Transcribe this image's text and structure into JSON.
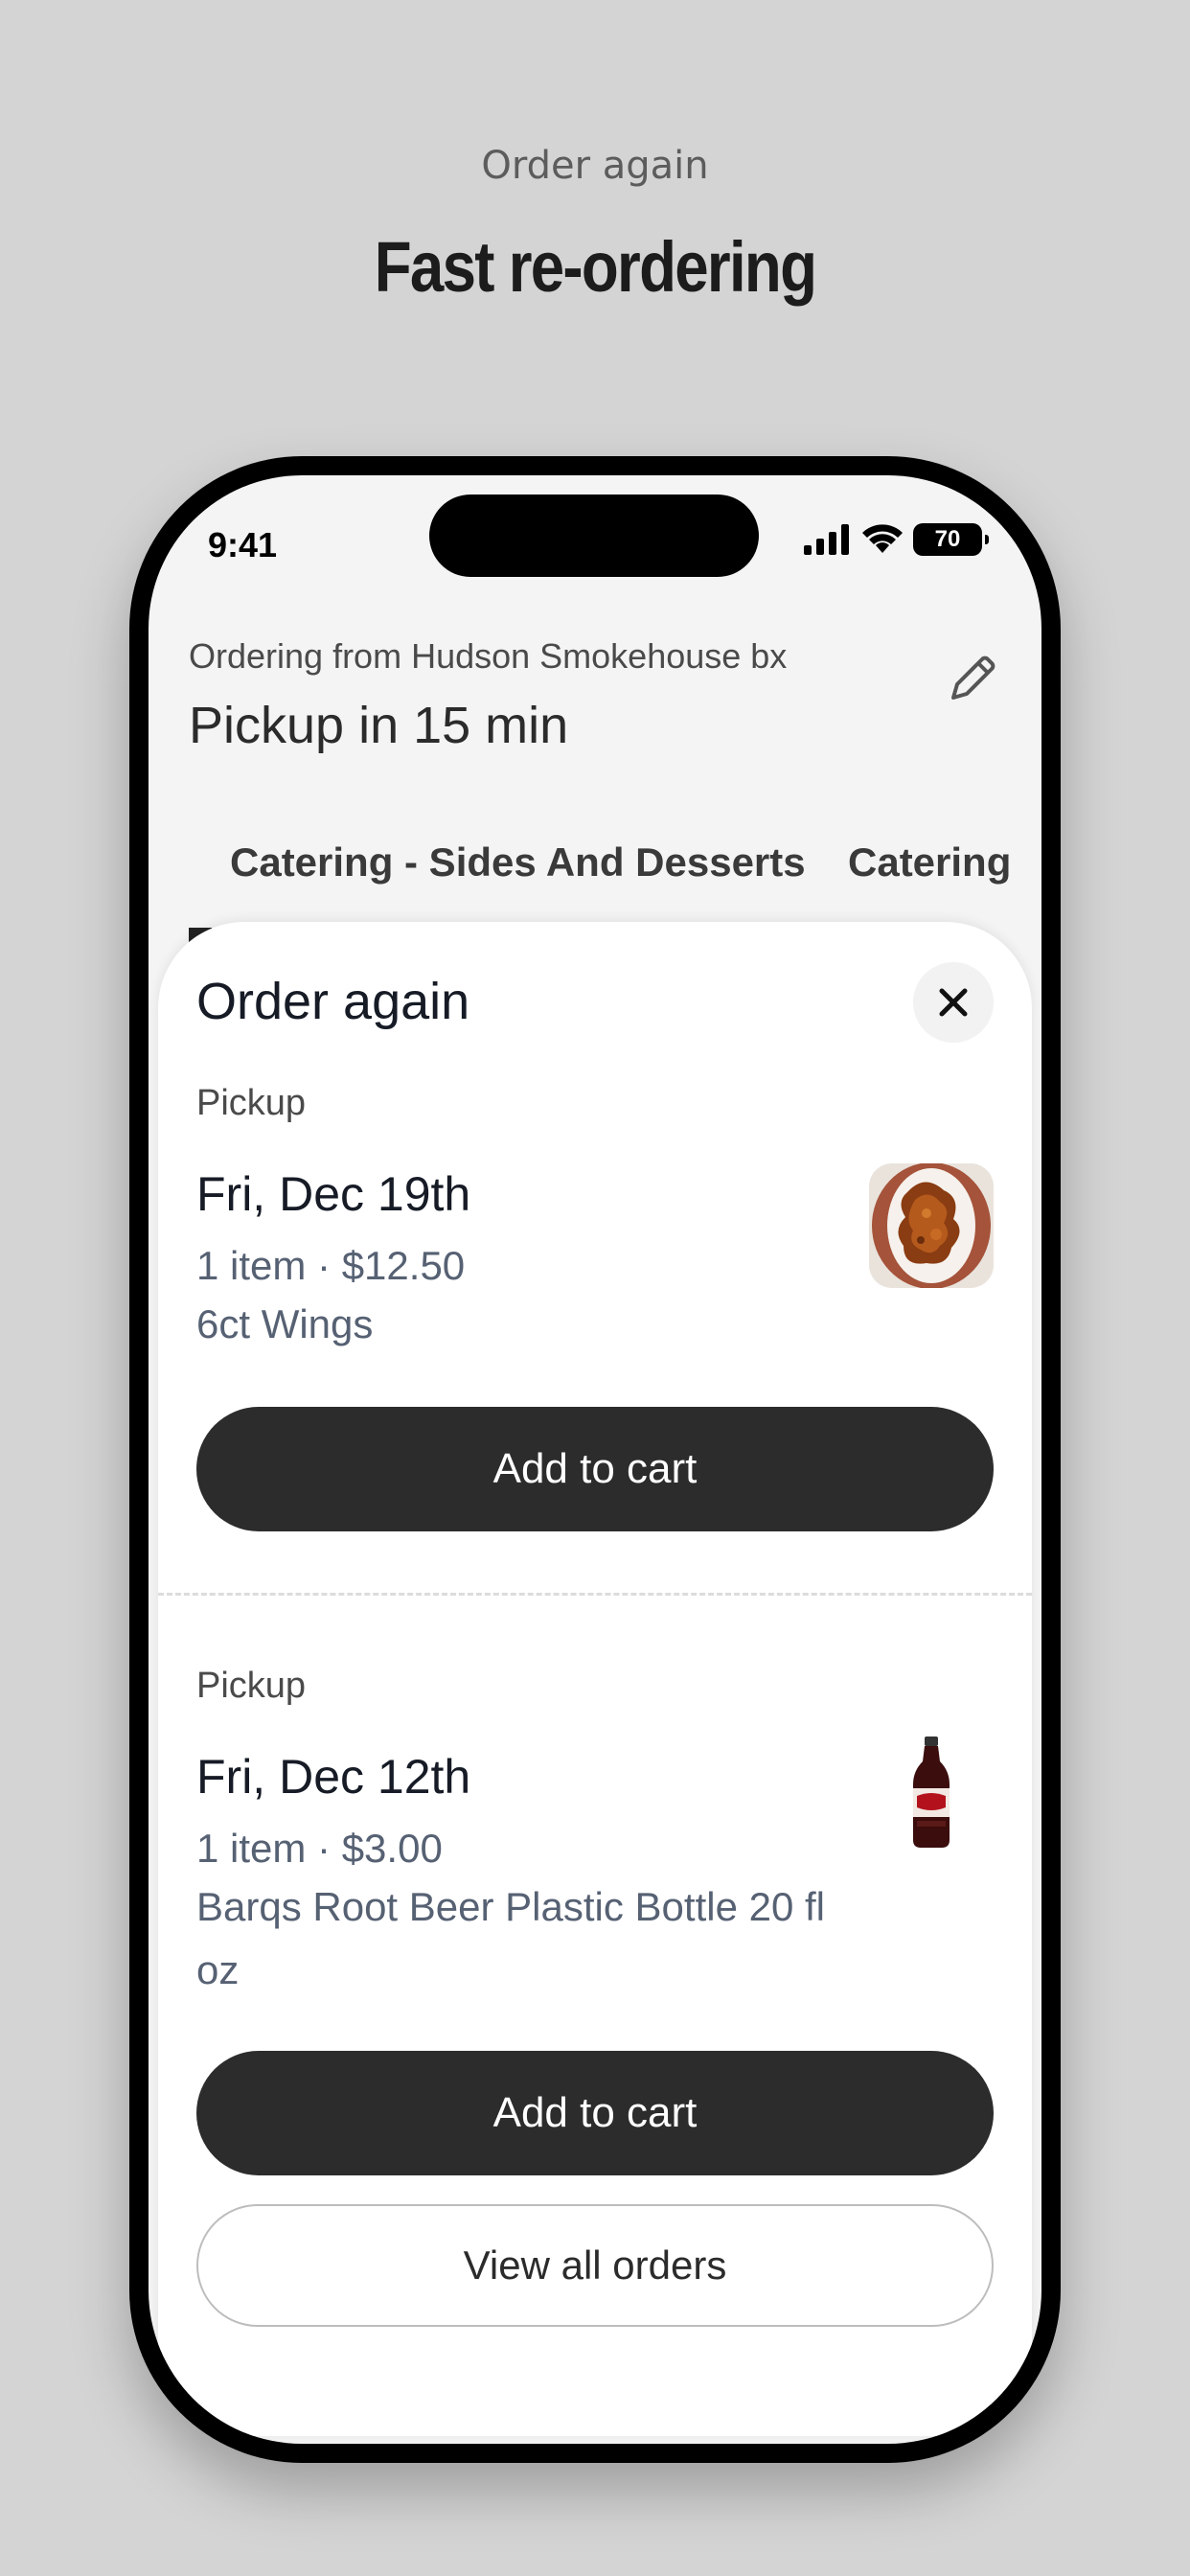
{
  "promo": {
    "eyebrow": "Order again",
    "title": "Fast re-ordering"
  },
  "status_bar": {
    "time": "9:41",
    "battery": "70",
    "icons": [
      "signal-icon",
      "wifi-icon",
      "battery-icon"
    ]
  },
  "header": {
    "ordering_from": "Ordering from Hudson Smokehouse bx",
    "pickup_time": "Pickup in 15 min",
    "edit_icon": "pencil-icon"
  },
  "category_tabs": [
    "Catering - Sides And Desserts",
    "Catering"
  ],
  "sheet": {
    "title": "Order again",
    "close_icon": "close-icon",
    "orders": [
      {
        "type": "Pickup",
        "date": "Fri, Dec 19th",
        "summary": "1 item · $12.50",
        "items": "6ct Wings",
        "button": "Add to cart",
        "thumb": "chicken-wings-image"
      },
      {
        "type": "Pickup",
        "date": "Fri, Dec 12th",
        "summary": "1 item · $3.00",
        "items": "Barqs Root Beer Plastic Bottle 20 fl oz",
        "button": "Add to cart",
        "thumb": "root-beer-bottle-image"
      }
    ],
    "view_all": "View all orders"
  },
  "colors": {
    "background": "#d4d4d4",
    "button_dark": "#2c2c2c",
    "muted_text": "#566173"
  }
}
